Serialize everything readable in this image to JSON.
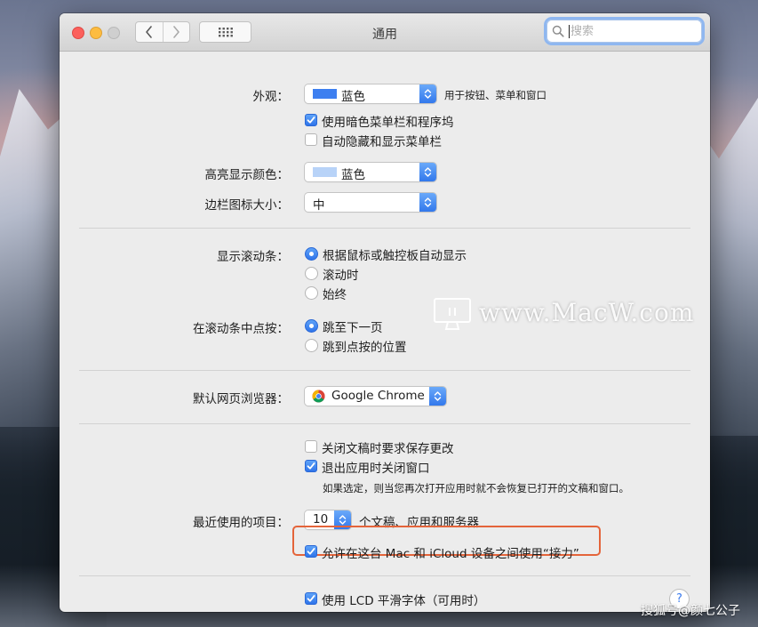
{
  "window": {
    "title": "通用"
  },
  "search": {
    "placeholder": "搜索",
    "value": ""
  },
  "appearance": {
    "label": "外观：",
    "value": "蓝色",
    "hint": "用于按钮、菜单和窗口",
    "swatch_color": "#3d7ff0",
    "dark_menu_bar": {
      "label": "使用暗色菜单栏和程序坞",
      "checked": true
    },
    "auto_hide_menu_bar": {
      "label": "自动隐藏和显示菜单栏",
      "checked": false
    }
  },
  "highlight_color": {
    "label": "高亮显示颜色：",
    "value": "蓝色",
    "swatch_color": "#b8d3f8"
  },
  "sidebar_icon_size": {
    "label": "边栏图标大小：",
    "value": "中"
  },
  "show_scroll_bars": {
    "label": "显示滚动条：",
    "options": [
      {
        "label": "根据鼠标或触控板自动显示",
        "selected": true
      },
      {
        "label": "滚动时",
        "selected": false
      },
      {
        "label": "始终",
        "selected": false
      }
    ]
  },
  "click_scroll_bar": {
    "label": "在滚动条中点按：",
    "options": [
      {
        "label": "跳至下一页",
        "selected": true
      },
      {
        "label": "跳到点按的位置",
        "selected": false
      }
    ]
  },
  "default_browser": {
    "label": "默认网页浏览器：",
    "value": "Google Chrome"
  },
  "documents": {
    "ask_keep_changes": {
      "label": "关闭文稿时要求保存更改",
      "checked": false
    },
    "close_windows_on_quit": {
      "label": "退出应用时关闭窗口",
      "checked": true
    },
    "note": "如果选定，则当您再次打开应用时就不会恢复已打开的文稿和窗口。"
  },
  "recent_items": {
    "label": "最近使用的项目：",
    "value": "10",
    "suffix": "个文稿、应用和服务器"
  },
  "handoff": {
    "label": "允许在这台 Mac 和 iCloud 设备之间使用“接力”",
    "checked": true,
    "highlight_color": "#e4643a"
  },
  "lcd_font_smoothing": {
    "label": "使用 LCD 平滑字体（可用时）",
    "checked": true
  },
  "help": {
    "label": "?"
  },
  "watermark": {
    "text": "www.MacW.com"
  },
  "credit": {
    "text": "搜狐号@颜七公子"
  }
}
